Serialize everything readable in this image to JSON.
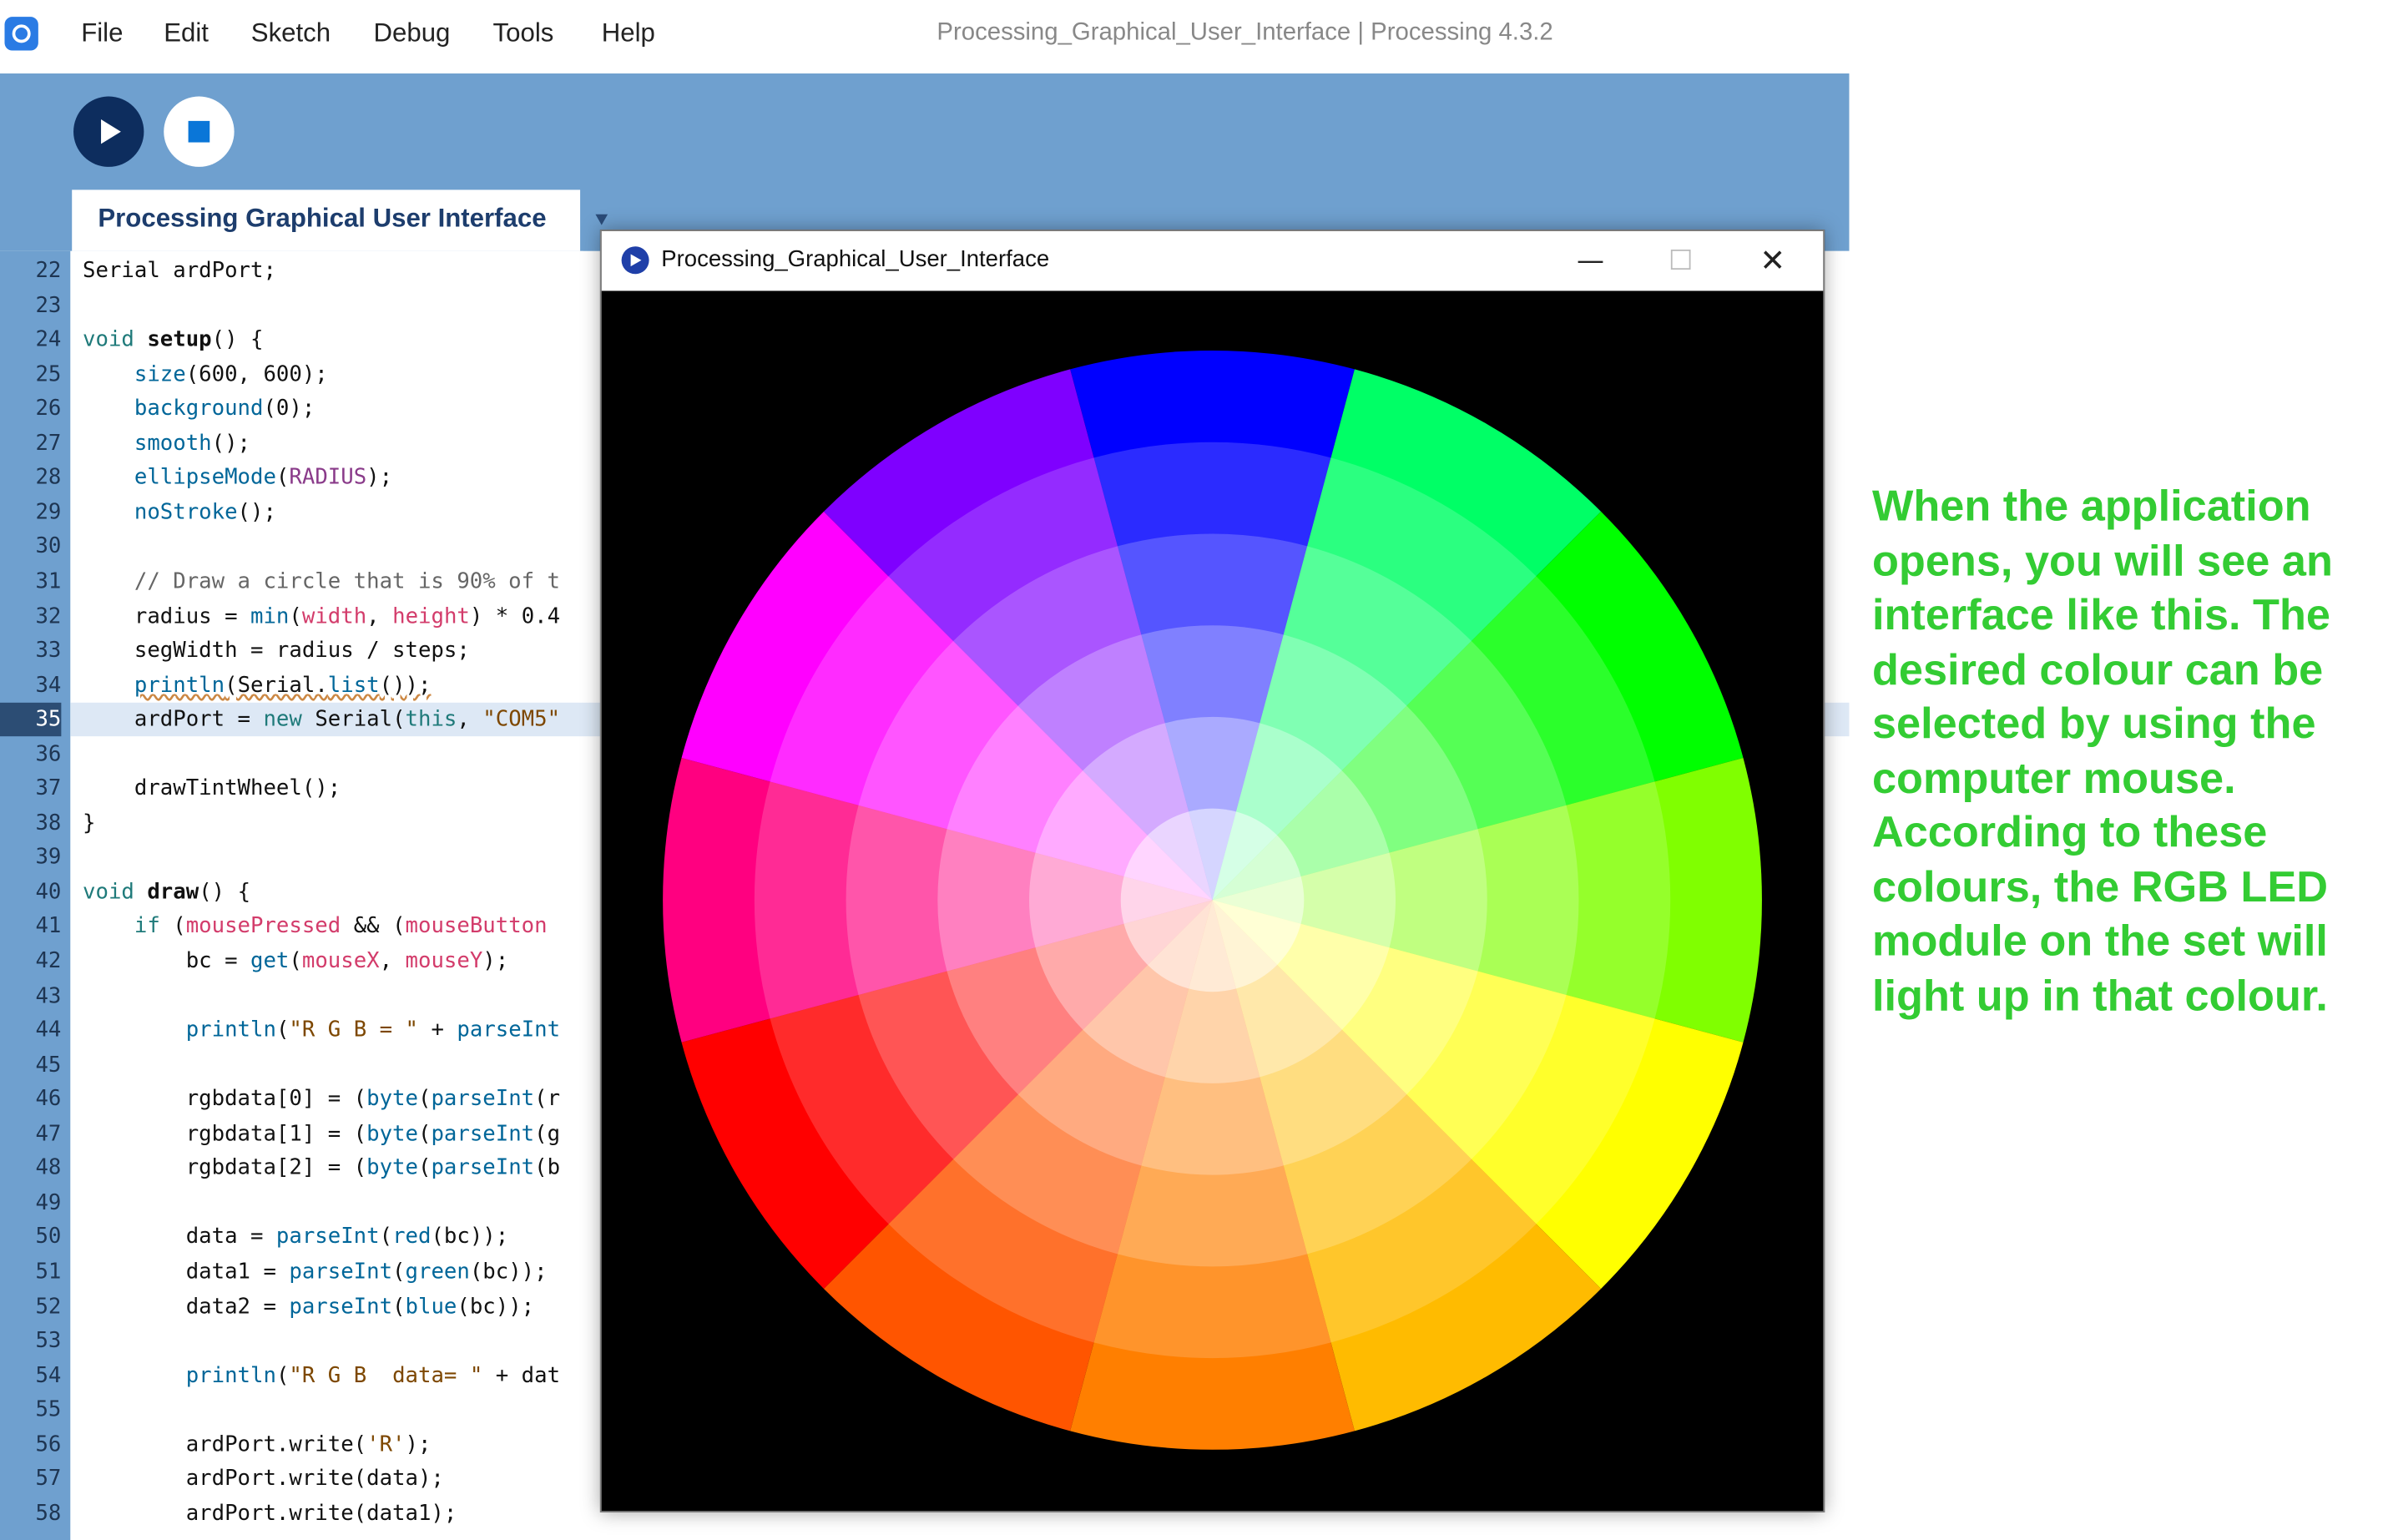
{
  "menu": [
    "File",
    "Edit",
    "Sketch",
    "Debug",
    "Tools",
    "Help"
  ],
  "window_title": "Processing_Graphical_User_Interface | Processing 4.3.2",
  "tab_label": "Processing Graphical User Interface",
  "popup_title": "Processing_Graphical_User_Interface",
  "current_line": 35,
  "code_lines": [
    {
      "n": "22",
      "html": "Serial ardPort;"
    },
    {
      "n": "23",
      "html": ""
    },
    {
      "n": "24",
      "html": "<span class='k'>void</span> <span class='f b'>setup</span>() {"
    },
    {
      "n": "25",
      "html": "    <span class='f'>size</span>(600, 600);"
    },
    {
      "n": "26",
      "html": "    <span class='f'>background</span>(0);"
    },
    {
      "n": "27",
      "html": "    <span class='f'>smooth</span>();"
    },
    {
      "n": "28",
      "html": "    <span class='f'>ellipseMode</span>(<span style='color:#8a3b8a'>RADIUS</span>);"
    },
    {
      "n": "29",
      "html": "    <span class='f'>noStroke</span>();"
    },
    {
      "n": "30",
      "html": ""
    },
    {
      "n": "31",
      "html": "    <span class='c'>// Draw a circle that is 90% of t</span>"
    },
    {
      "n": "32",
      "html": "    radius = <span class='f'>min</span>(<span style='color:#d33c6b'>width</span>, <span style='color:#d33c6b'>height</span>) * 0.4"
    },
    {
      "n": "33",
      "html": "    segWidth = radius / steps;"
    },
    {
      "n": "34",
      "html": "    <span class='f sq-err'>println</span><span class='sq-err'>(Serial.<span class='f'>list</span>());</span>"
    },
    {
      "n": "35",
      "html": "    ardPort = <span class='k'>new</span> Serial(<span class='k'>this</span>, <span class='s'>\"COM5\"</span>"
    },
    {
      "n": "36",
      "html": ""
    },
    {
      "n": "37",
      "html": "    drawTintWheel();"
    },
    {
      "n": "38",
      "html": "}"
    },
    {
      "n": "39",
      "html": ""
    },
    {
      "n": "40",
      "html": "<span class='k'>void</span> <span class='f b'>draw</span>() {"
    },
    {
      "n": "41",
      "html": "    <span class='k'>if</span> (<span style='color:#d33c6b'>mousePressed</span> &amp;&amp; (<span style='color:#d33c6b'>mouseButton</span>"
    },
    {
      "n": "42",
      "html": "        bc = <span class='f'>get</span>(<span style='color:#d33c6b'>mouseX</span>, <span style='color:#d33c6b'>mouseY</span>);"
    },
    {
      "n": "43",
      "html": ""
    },
    {
      "n": "44",
      "html": "        <span class='f'>println</span>(<span class='s'>\"R G B = \"</span> + <span class='f'>parseInt</span>"
    },
    {
      "n": "45",
      "html": ""
    },
    {
      "n": "46",
      "html": "        rgbdata[0] = (<span class='f'>byte</span>(<span class='f'>parseInt</span>(r"
    },
    {
      "n": "47",
      "html": "        rgbdata[1] = (<span class='f'>byte</span>(<span class='f'>parseInt</span>(g"
    },
    {
      "n": "48",
      "html": "        rgbdata[2] = (<span class='f'>byte</span>(<span class='f'>parseInt</span>(b"
    },
    {
      "n": "49",
      "html": ""
    },
    {
      "n": "50",
      "html": "        data = <span class='f'>parseInt</span>(<span class='f'>red</span>(bc));"
    },
    {
      "n": "51",
      "html": "        data1 = <span class='f'>parseInt</span>(<span class='f'>green</span>(bc));"
    },
    {
      "n": "52",
      "html": "        data2 = <span class='f'>parseInt</span>(<span class='f'>blue</span>(bc));"
    },
    {
      "n": "53",
      "html": ""
    },
    {
      "n": "54",
      "html": "        <span class='f'>println</span>(<span class='s'>\"R G B  data= \"</span> + dat"
    },
    {
      "n": "55",
      "html": ""
    },
    {
      "n": "56",
      "html": "        ardPort.write(<span class='s'>'R'</span>);"
    },
    {
      "n": "57",
      "html": "        ardPort.write(data);"
    },
    {
      "n": "58",
      "html": "        ardPort.write(data1);"
    }
  ],
  "wheel": {
    "hues": [
      "#0000ff",
      "#00ff66",
      "#00ff00",
      "#80ff00",
      "#ffff00",
      "#ffbb00",
      "#ff7f00",
      "#ff5500",
      "#ff0000",
      "#ff0080",
      "#ff00ff",
      "#7f00ff"
    ],
    "rings": 6,
    "background": "#000000"
  },
  "caption": "When the application opens, you will see an interface like this. The desired colour can be selected by using the computer mouse. According to these colours, the RGB LED module on the set will light up in that colour.",
  "colors": {
    "accent": "#6fa0cf",
    "caption": "#33cc33"
  }
}
